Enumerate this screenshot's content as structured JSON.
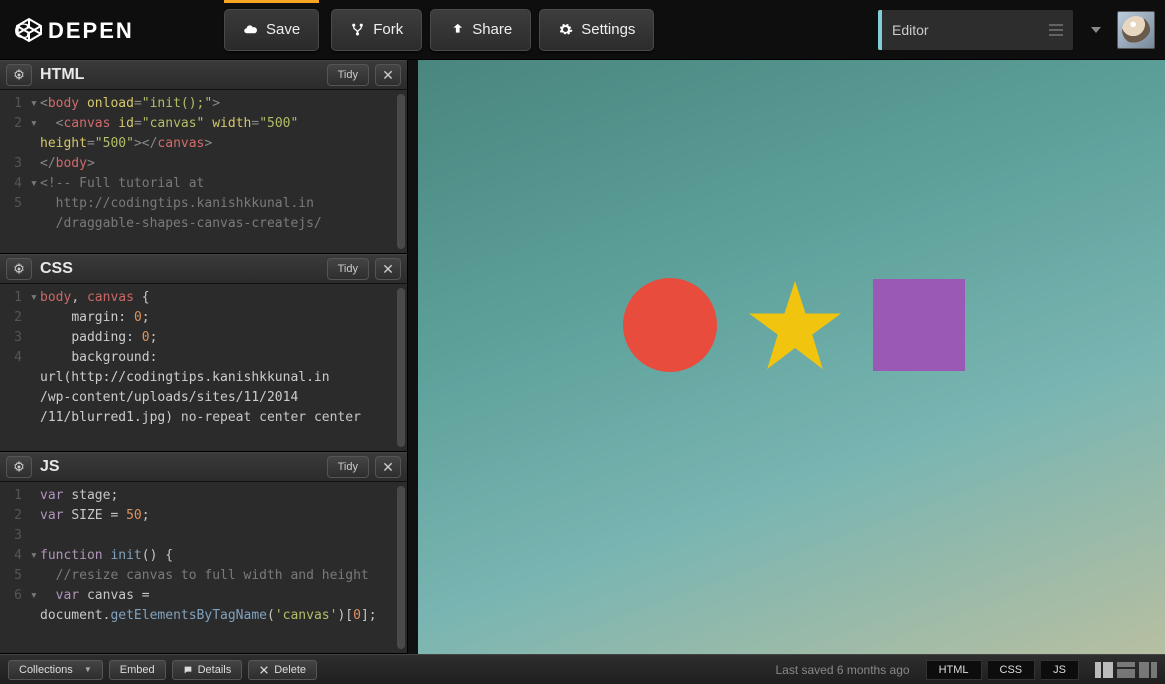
{
  "header": {
    "logo_text": "CODEPEN",
    "buttons": {
      "save": "Save",
      "fork": "Fork",
      "share": "Share",
      "settings": "Settings"
    },
    "view_label": "Editor"
  },
  "panes": {
    "html": {
      "title": "HTML",
      "tidy": "Tidy",
      "lines": [
        {
          "n": "1",
          "fold": "▾",
          "html": "<span class='t-ang'>&lt;</span><span class='t-tag'>body</span> <span class='t-attr'>onload</span><span class='t-ang'>=</span><span class='t-str'>\"init();\"</span><span class='t-ang'>&gt;</span>"
        },
        {
          "n": "2",
          "fold": "▾",
          "html": "  <span class='t-ang'>&lt;</span><span class='t-tag'>canvas</span> <span class='t-attr'>id</span><span class='t-ang'>=</span><span class='t-str'>\"canvas\"</span> <span class='t-attr'>width</span><span class='t-ang'>=</span><span class='t-str'>\"500\"</span> <span class='t-attr'>height</span><span class='t-ang'>=</span><span class='t-str'>\"500\"</span><span class='t-ang'>&gt;&lt;/</span><span class='t-tag'>canvas</span><span class='t-ang'>&gt;</span>"
        },
        {
          "n": "3",
          "fold": "",
          "html": "<span class='t-ang'>&lt;/</span><span class='t-tag'>body</span><span class='t-ang'>&gt;</span>"
        },
        {
          "n": "4",
          "fold": "▾",
          "html": "<span class='t-com'>&lt;!-- Full tutorial at</span>"
        },
        {
          "n": "5",
          "fold": "",
          "html": "<span class='t-com'>  http://codingtips.kanishkkunal.in</span>"
        },
        {
          "n": "",
          "fold": "",
          "html": "<span class='t-com'>  /draggable-shapes-canvas-createjs/</span>"
        }
      ]
    },
    "css": {
      "title": "CSS",
      "tidy": "Tidy",
      "lines": [
        {
          "n": "1",
          "fold": "▾",
          "html": "<span class='t-sel'>body</span><span class='t-id'>, </span><span class='t-sel'>canvas</span> <span class='t-id'>{</span>"
        },
        {
          "n": "2",
          "fold": "",
          "html": "    <span class='t-prop'>margin</span><span class='t-id'>:</span> <span class='t-num'>0</span><span class='t-id'>;</span>"
        },
        {
          "n": "3",
          "fold": "",
          "html": "    <span class='t-prop'>padding</span><span class='t-id'>:</span> <span class='t-num'>0</span><span class='t-id'>;</span>"
        },
        {
          "n": "4",
          "fold": "",
          "html": "    <span class='t-prop'>background</span><span class='t-id'>:</span>"
        },
        {
          "n": "",
          "fold": "",
          "html": "<span class='t-url'>url(http://codingtips.kanishkkunal.in</span>"
        },
        {
          "n": "",
          "fold": "",
          "html": "<span class='t-url'>/wp-content/uploads/sites/11/2014</span>"
        },
        {
          "n": "",
          "fold": "",
          "html": "<span class='t-url'>/11/blurred1.jpg)</span> <span class='t-id'>no-repeat center center</span>"
        }
      ]
    },
    "js": {
      "title": "JS",
      "tidy": "Tidy",
      "lines": [
        {
          "n": "1",
          "fold": "",
          "html": "<span class='t-kw'>var</span> <span class='t-id'>stage;</span>"
        },
        {
          "n": "2",
          "fold": "",
          "html": "<span class='t-kw'>var</span> <span class='t-id'>SIZE = </span><span class='t-num'>50</span><span class='t-id'>;</span>"
        },
        {
          "n": "3",
          "fold": "",
          "html": ""
        },
        {
          "n": "4",
          "fold": "▾",
          "html": "<span class='t-kw'>function</span> <span class='t-fn'>init</span><span class='t-id'>() {</span>"
        },
        {
          "n": "5",
          "fold": "",
          "html": "  <span class='t-com'>//resize canvas to full width and height</span>"
        },
        {
          "n": "6",
          "fold": "▾",
          "html": "  <span class='t-kw'>var</span> <span class='t-id'>canvas =</span>"
        },
        {
          "n": "",
          "fold": "",
          "html": "<span class='t-id'>document.</span><span class='t-fn'>getElementsByTagName</span><span class='t-id'>(</span><span class='t-str'>'canvas'</span><span class='t-id'>)[</span><span class='t-num'>0</span><span class='t-id'>];</span>"
        }
      ]
    }
  },
  "footer": {
    "collections": "Collections",
    "embed": "Embed",
    "details": "Details",
    "delete": "Delete",
    "status": "Last saved 6 months ago",
    "tabs": {
      "html": "HTML",
      "css": "CSS",
      "js": "JS"
    }
  },
  "shapes": {
    "circle_color": "#e74c3c",
    "star_color": "#f1c40f",
    "square_color": "#9b59b6"
  }
}
